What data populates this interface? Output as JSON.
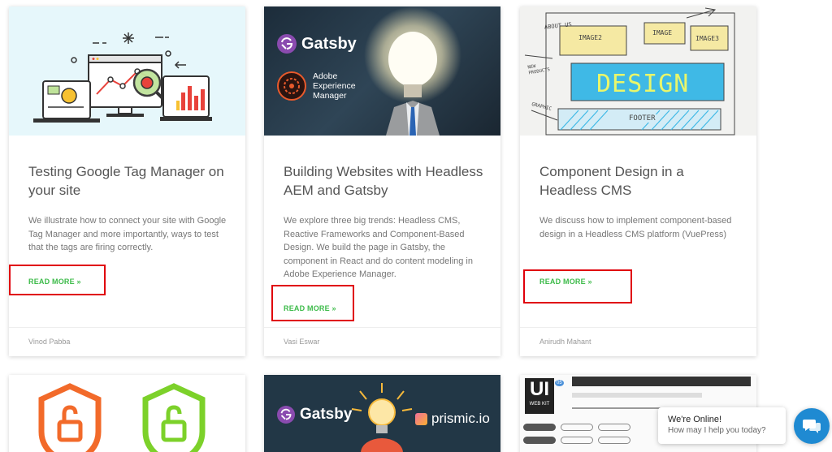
{
  "cards": [
    {
      "title": "Testing Google Tag Manager on your site",
      "excerpt": "We illustrate how to connect your site with Google Tag Manager and more importantly, ways to test that the tags are firing correctly.",
      "read_more": "READ MORE »",
      "author": "Vinod Pabba"
    },
    {
      "title": "Building Websites with Headless AEM and Gatsby",
      "excerpt": "We explore three big trends: Headless CMS, Reactive Frameworks and Component-Based Design. We build the page in Gatsby, the component in React and do content modeling in Adobe Experience Manager.",
      "read_more": "READ MORE »",
      "author": "Vasi Eswar",
      "thumb_gatsby": "Gatsby",
      "thumb_aem": [
        "Adobe",
        "Experience",
        "Manager"
      ]
    },
    {
      "title": "Component Design in a Headless CMS",
      "excerpt": "We discuss how to implement component-based design in a Headless CMS platform (VuePress)",
      "read_more": "READ MORE »",
      "author": "Anirudh Mahant",
      "thumb_labels": {
        "about": "ABOUT US",
        "image2": "IMAGE2",
        "image": "IMAGE",
        "image3": "IMAGE3",
        "design": "DESIGN",
        "new_products": "NEW PRODUCTS",
        "graphic": "GRAPHIC",
        "footer": "FOOTER"
      }
    }
  ],
  "row2": {
    "gatsby": "Gatsby",
    "prismic": "prismic.io",
    "ui_kit_big": "UI",
    "ui_kit_small": "WEB KIT",
    "ui_kit_num": "05"
  },
  "chat": {
    "title": "We're Online!",
    "subtitle": "How may I help you today?"
  },
  "colors": {
    "accent_green": "#3dbb4a",
    "highlight_red": "#e0000b",
    "chat_blue": "#1f8ad2"
  }
}
